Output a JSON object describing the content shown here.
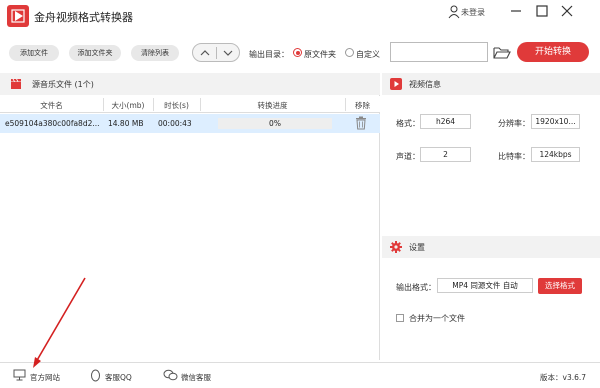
{
  "app": {
    "title": "金舟视频格式转换器",
    "login": "未登录"
  },
  "toolbar": {
    "add_file": "添加文件",
    "add_folder": "添加文件夹",
    "clear_list": "清除列表",
    "output_dir_label": "输出目录：",
    "radio_source": "原文件夹",
    "radio_custom": "自定义",
    "path_value": "",
    "start": "开始转换"
  },
  "files": {
    "header": "源音乐文件 (1个)",
    "columns": {
      "name": "文件名",
      "size": "大小(mb)",
      "duration": "时长(s)",
      "progress": "转换进度",
      "remove": "移除"
    },
    "rows": [
      {
        "name": "e509104a380c00fa8d2...",
        "size": "14.80 MB",
        "duration": "00:00:43",
        "progress_text": "0%",
        "progress": 0
      }
    ]
  },
  "video_info": {
    "header": "视频信息",
    "format_label": "格式：",
    "format": "h264",
    "resolution_label": "分辨率：",
    "resolution": "1920x10...",
    "channels_label": "声道：",
    "channels": "2",
    "bitrate_label": "比特率：",
    "bitrate": "124kbps"
  },
  "settings": {
    "header": "设置",
    "output_format_label": "输出格式：",
    "output_format": "MP4 同源文件 自动",
    "select_format": "选择格式",
    "merge_label": "合并为一个文件",
    "merge_checked": false
  },
  "statusbar": {
    "website": "官方网站",
    "qq": "客服QQ",
    "wechat": "微信客服",
    "version": "版本：v3.6.7"
  },
  "colors": {
    "accent": "#e03a3a",
    "selected_row": "#ddeeff",
    "panel_header": "#f2f2f2"
  }
}
